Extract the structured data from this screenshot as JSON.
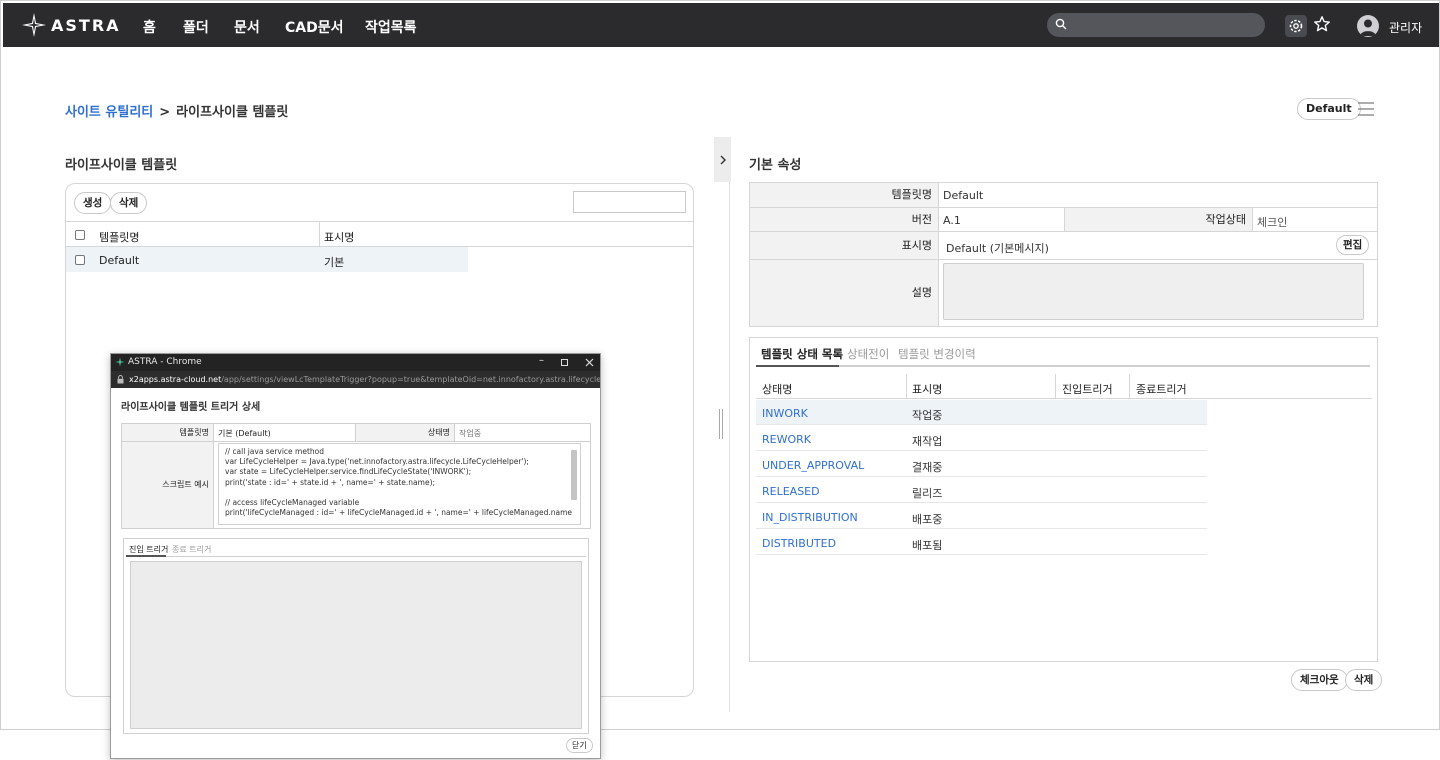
{
  "app": {
    "logo_text": "ASTRA",
    "user_name": "관리자"
  },
  "nav": {
    "items": [
      "홈",
      "폴더",
      "문서",
      "CAD문서",
      "작업목록"
    ]
  },
  "breadcrumb": {
    "parent": "사이트 유틸리티",
    "separator": ">",
    "current": "라이프사이클 템플릿"
  },
  "header_right": {
    "profile_label": "Default"
  },
  "left": {
    "title": "라이프사이클 템플릿",
    "create_label": "생성",
    "delete_label": "삭제",
    "columns": [
      "템플릿명",
      "표시명"
    ],
    "rows": [
      {
        "name": "Default",
        "display": "기본"
      }
    ]
  },
  "right": {
    "title": "기본 속성",
    "props": {
      "template_name_label": "템플릿명",
      "template_name": "Default",
      "version_label": "버전",
      "version": "A.1",
      "work_state_label": "작업상태",
      "work_state": "체크인",
      "display_label": "표시명",
      "display": "Default (기본메시지)",
      "edit_label": "편집",
      "desc_label": "설명"
    },
    "tabs": [
      "템플릿 상태 목록",
      "상태전이",
      "템플릿 변경이력"
    ],
    "state_columns": [
      "상태명",
      "표시명",
      "진입트리거",
      "종료트리거"
    ],
    "states": [
      {
        "name": "INWORK",
        "display": "작업중"
      },
      {
        "name": "REWORK",
        "display": "재작업"
      },
      {
        "name": "UNDER_APPROVAL",
        "display": "결재중"
      },
      {
        "name": "RELEASED",
        "display": "릴리즈"
      },
      {
        "name": "IN_DISTRIBUTION",
        "display": "배포중"
      },
      {
        "name": "DISTRIBUTED",
        "display": "배포됨"
      }
    ],
    "checkout_label": "체크아웃",
    "delete_label": "삭제"
  },
  "popup": {
    "window_title": "ASTRA - Chrome",
    "url_host": "x2apps.astra-cloud.net",
    "url_path": "/app/settings/viewLcTemplateTrigger?popup=true&templateOid=net.innofactory.astra.lifecycle.LifeCycleTemplate%...",
    "heading": "라이프사이클 템플릿 트리거 상세",
    "template_label": "템플릿명",
    "template_value": "기본 (Default)",
    "state_label": "상태명",
    "state_value": "작업중",
    "script_label": "스크립트 예시",
    "code": "// call java service method\nvar LifeCycleHelper = Java.type('net.innofactory.astra.lifecycle.LifeCycleHelper');\nvar state = LifeCycleHelper.service.findLifeCycleState('INWORK');\nprint('state : id=' + state.id + ', name=' + state.name);\n\n// access lifeCycleManaged variable\nprint('lifeCycleManaged : id=' + lifeCycleManaged.id + ', name=' + lifeCycleManaged.name",
    "tabs": [
      "진입 트리거",
      "종료 트리거"
    ],
    "close_label": "닫기"
  }
}
